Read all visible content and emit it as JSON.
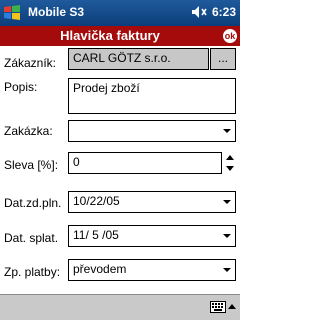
{
  "titlebar": {
    "app_title": "Mobile S3",
    "time": "6:23",
    "icons": [
      "windows-flag-icon",
      "speaker-icon"
    ]
  },
  "form": {
    "title": "Hlavička faktury",
    "ok_label": "ok",
    "fields": {
      "zakaznik": {
        "label": "Zákazník:",
        "value": "CARL GÖTZ s.r.o.",
        "button": "..."
      },
      "popis": {
        "label": "Popis:",
        "value": "Prodej zboží"
      },
      "zakazka": {
        "label": "Zakázka:",
        "value": ""
      },
      "sleva": {
        "label": "Sleva [%]:",
        "value": "0"
      },
      "dat_zd_pln": {
        "label": "Dat.zd.pln.",
        "value": "10/22/05"
      },
      "dat_splat": {
        "label": "Dat. splat.",
        "value": "11/ 5 /05"
      },
      "zp_platby": {
        "label": "Zp. platby:",
        "value": "převodem"
      }
    }
  },
  "bottombar": {
    "icons": [
      "keyboard-icon",
      "sip-up-arrow-icon"
    ]
  },
  "colors": {
    "titlebar": "#0b3d7a",
    "header": "#a50b0b",
    "readonly_field": "#c7c7c7",
    "bottombar": "#c9c9c9"
  }
}
